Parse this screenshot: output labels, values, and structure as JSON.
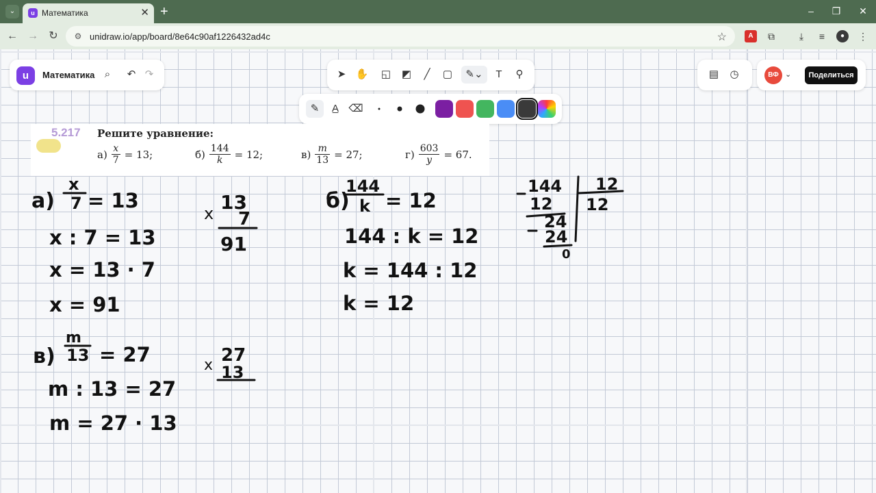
{
  "browser": {
    "tab_title": "Математика",
    "tab_favicon": "unidraw-logo-icon",
    "url": "unidraw.io/app/board/8e64c90af1226432ad4c"
  },
  "app": {
    "board_title": "Математика",
    "avatar_initials": "ВФ",
    "share_label": "Поделиться",
    "colors": [
      "#7b1fa2",
      "#ef5350",
      "#43b65f",
      "#4a8df6",
      "#3a3a3a",
      "rainbow"
    ],
    "selected_color": "#3a3a3a",
    "brand_color": "#7b3fe4"
  },
  "problem": {
    "number": "5.217",
    "title": "Решите уравнение:",
    "items": [
      {
        "label": "а)",
        "num": "x",
        "den": "7",
        "rhs": "= 13;"
      },
      {
        "label": "б)",
        "num": "144",
        "den": "k",
        "rhs": "= 12;"
      },
      {
        "label": "в)",
        "num": "m",
        "den": "13",
        "rhs": "= 27;"
      },
      {
        "label": "г)",
        "num": "603",
        "den": "y",
        "rhs": "= 67."
      }
    ]
  },
  "handwriting": {
    "a_label": "а)",
    "a_frac_num": "x",
    "a_frac_den": "7",
    "a_frac_rhs": "= 13",
    "a_line1": "x : 7 = 13",
    "a_line2": "x = 13 · 7",
    "a_line3": "x = 91",
    "a_mult_top": "13",
    "a_mult_bottom": "7",
    "a_mult_result": "91",
    "b_label": "б)",
    "b_frac_num": "144",
    "b_frac_den": "k",
    "b_frac_rhs": "= 12",
    "b_line1": "144 : k = 12",
    "b_line2": "k = 144 : 12",
    "b_line3": "k = 12",
    "div_dividend": "144",
    "div_divisor": "12",
    "div_quotient": "12",
    "div_sub1": "12",
    "div_rem1": "24",
    "div_sub2": "24",
    "div_rem2": "0",
    "v_label": "в)",
    "v_frac_num": "m",
    "v_frac_den": "13",
    "v_frac_rhs": "= 27",
    "v_line1": "m : 13 = 27",
    "v_line2": "m = 27 · 13",
    "v_mult_top": "27",
    "v_mult_bottom": "13"
  }
}
